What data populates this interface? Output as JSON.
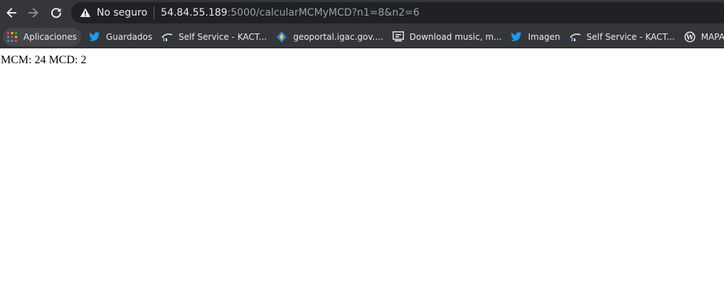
{
  "toolbar": {
    "security_label": "No seguro",
    "url_host": "54.84.55.189",
    "url_rest": ":5000/calcularMCMyMCD?n1=8&n2=6",
    "icons": [
      "back-arrow-icon",
      "forward-arrow-icon",
      "reload-icon",
      "warning-icon"
    ]
  },
  "bookmarks": [
    {
      "label": "Aplicaciones",
      "icon": "apps-grid-icon"
    },
    {
      "label": "Guardados",
      "icon": "twitter-bird-icon"
    },
    {
      "label": "Self Service - KACT...",
      "icon": "self-service-icon"
    },
    {
      "label": "geoportal.igac.gov....",
      "icon": "geoportal-icon"
    },
    {
      "label": "Download music, m...",
      "icon": "download-music-icon"
    },
    {
      "label": "Imagen",
      "icon": "twitter-bird-icon"
    },
    {
      "label": "Self Service - KACT...",
      "icon": "self-service-icon"
    },
    {
      "label": "MAPAS | LA GRA",
      "icon": "wordpress-icon"
    }
  ],
  "page": {
    "text": "MCM: 24 MCD: 2"
  },
  "colors": {
    "toolbar_bg": "#35363a",
    "omnibox_bg": "#202124",
    "text_light": "#e8eaed",
    "twitter_blue": "#1d9bf0"
  }
}
